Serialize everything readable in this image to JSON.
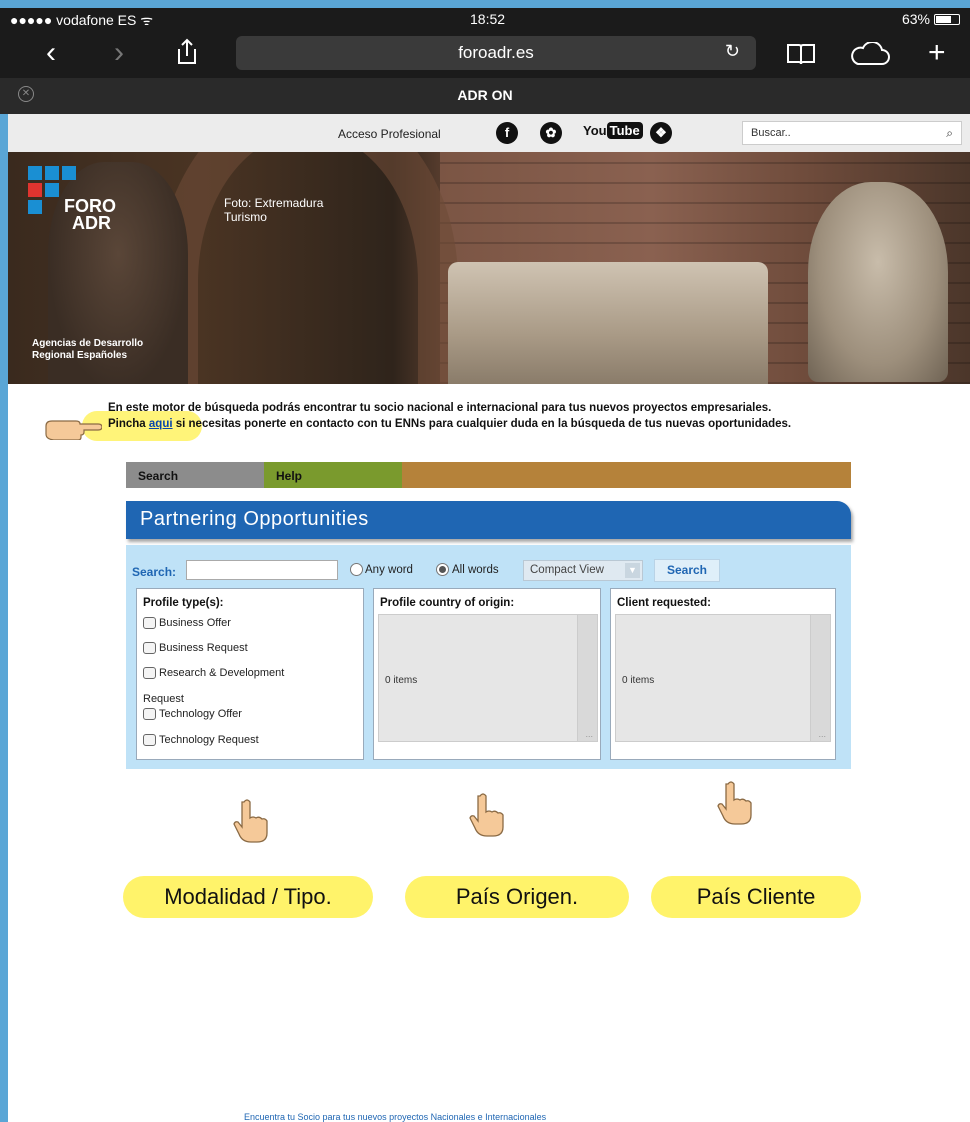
{
  "status_bar": {
    "carrier": "●●●●● vodafone ES ᯤ",
    "time": "18:52",
    "battery": "63%"
  },
  "browser": {
    "url": "foroadr.es",
    "tab_title": "ADR ON",
    "icons": [
      "back-icon",
      "forward-icon",
      "share-icon",
      "reload-icon",
      "bookmarks-icon",
      "cloud-tabs-icon",
      "new-tab-icon",
      "close-tab-icon"
    ]
  },
  "site_bar": {
    "professional_access": "Acceso Profesional",
    "social": [
      "facebook-icon",
      "twitter-icon",
      "youtube-icon",
      "google-plus-icon"
    ],
    "youtube_text_a": "You",
    "youtube_text_b": "Tube",
    "search_placeholder": "Buscar..",
    "search_icon": "⌕"
  },
  "hero": {
    "logo_line1": "FORO",
    "logo_line2": "ADR",
    "photo_credit_line1": "Foto: Extremadura",
    "photo_credit_line2": "Turismo",
    "agencies_line1": "Agencias de Desarrollo",
    "agencies_line2": "Regional Españoles",
    "logo_colors": [
      "#1a8fd3",
      "#1a8fd3",
      "#1a8fd3",
      "#e0342f",
      "#1a8fd3",
      "#1a8fd3"
    ]
  },
  "intro": {
    "line1": "En este motor de búsqueda podrás encontrar tu socio nacional e internacional para tus nuevos proyectos empresariales.",
    "line2_prefix": "Pincha ",
    "link": "aqui",
    "line2_suffix": " si necesitas ponerte en contacto con tu ENNs para cualquier duda en la búsqueda de tus nuevas oportunidades."
  },
  "tabs": {
    "search": "Search",
    "help": "Help"
  },
  "partnering": {
    "title": "Partnering Opportunities",
    "search_label": "Search:",
    "search_value": "",
    "radio_any": "Any word",
    "radio_all": "All words",
    "view_select": "Compact View",
    "search_button": "Search",
    "profile_types_head": "Profile type(s):",
    "profile_types": [
      "Business Offer",
      "Business Request",
      "Research & Development",
      "Technology Offer",
      "Technology Request"
    ],
    "profile_types_wrap": "Request",
    "country_head": "Profile country of origin:",
    "country_count": "0 items",
    "client_head": "Client requested:",
    "client_count": "0 items",
    "scroll_dots": "..."
  },
  "callouts": {
    "type": "Modalidad / Tipo.",
    "origin": "País Origen.",
    "client": "País Cliente"
  },
  "footer": {
    "text": "Encuentra tu Socio para tus nuevos proyectos Nacionales e Internacionales"
  },
  "colors": {
    "accent_blue": "#1f66b3",
    "panel_blue": "#bfe2f7",
    "highlight_yellow": "#fff36a",
    "tab_search": "#8c8c8c",
    "tab_help": "#7a9a2d",
    "tab_bar": "#b5823a"
  }
}
